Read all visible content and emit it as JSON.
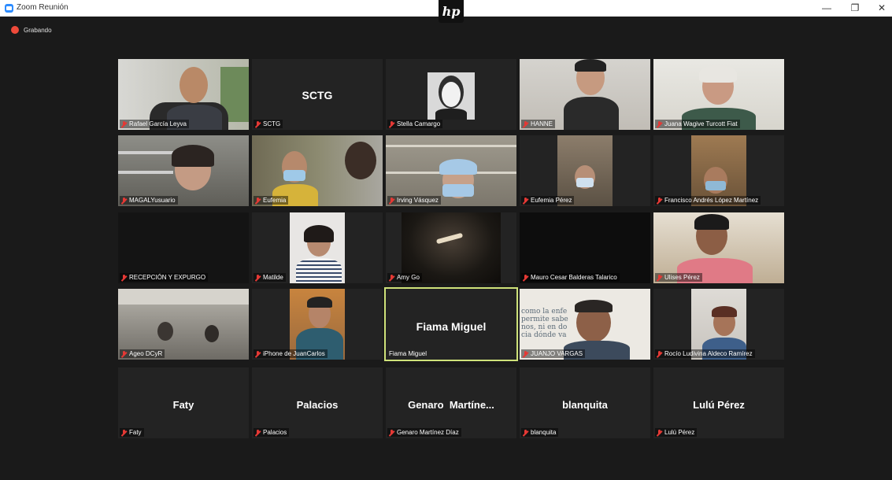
{
  "window": {
    "title": "Zoom Reunión"
  },
  "brand": {
    "logo_text": "hp"
  },
  "controls": {
    "minimize": "—",
    "maximize": "❐",
    "close": "✕"
  },
  "recording": {
    "label": "Grabando"
  },
  "participants": [
    {
      "name": "Rafael García Leyva"
    },
    {
      "name": "SCTG",
      "display": "SCTG"
    },
    {
      "name": "Stella Camargo"
    },
    {
      "name": "HANNE"
    },
    {
      "name": "Juana Wagive Turcott Fiat"
    },
    {
      "name": "MAGALYusuario"
    },
    {
      "name": "Eufemia"
    },
    {
      "name": "Irving Vásquez"
    },
    {
      "name": "Eufemia Pérez"
    },
    {
      "name": "Francisco Andrés López Martínez"
    },
    {
      "name": "RECEPCIÓN Y EXPURGO"
    },
    {
      "name": "Matilde"
    },
    {
      "name": "Amy Go"
    },
    {
      "name": "Mauro Cesar Balderas Talarico"
    },
    {
      "name": "Ulises Pérez"
    },
    {
      "name": "Ageo DCyR"
    },
    {
      "name": "iPhone de JuanCarlos"
    },
    {
      "name": "Fiama Miguel",
      "display": "Fiama Miguel"
    },
    {
      "name": "JUANJO VARGAS",
      "bg_text": "como la enfe permite sabe nos, ni en do cia dónde va"
    },
    {
      "name": "Rocío Ludivina Aldeco Ramírez"
    },
    {
      "name": "Faty",
      "display": "Faty"
    },
    {
      "name": "Palacios",
      "display": "Palacios"
    },
    {
      "name": "Genaro Martínez Díaz",
      "display": "Genaro  Martíne..."
    },
    {
      "name": "blanquita",
      "display": "blanquita"
    },
    {
      "name": "Lulú Pérez",
      "display": "Lulú Pérez"
    }
  ],
  "colors": {
    "active_speaker_border": "#cfe27a",
    "muted_icon": "#e53935",
    "record": "#ef4a3a"
  }
}
